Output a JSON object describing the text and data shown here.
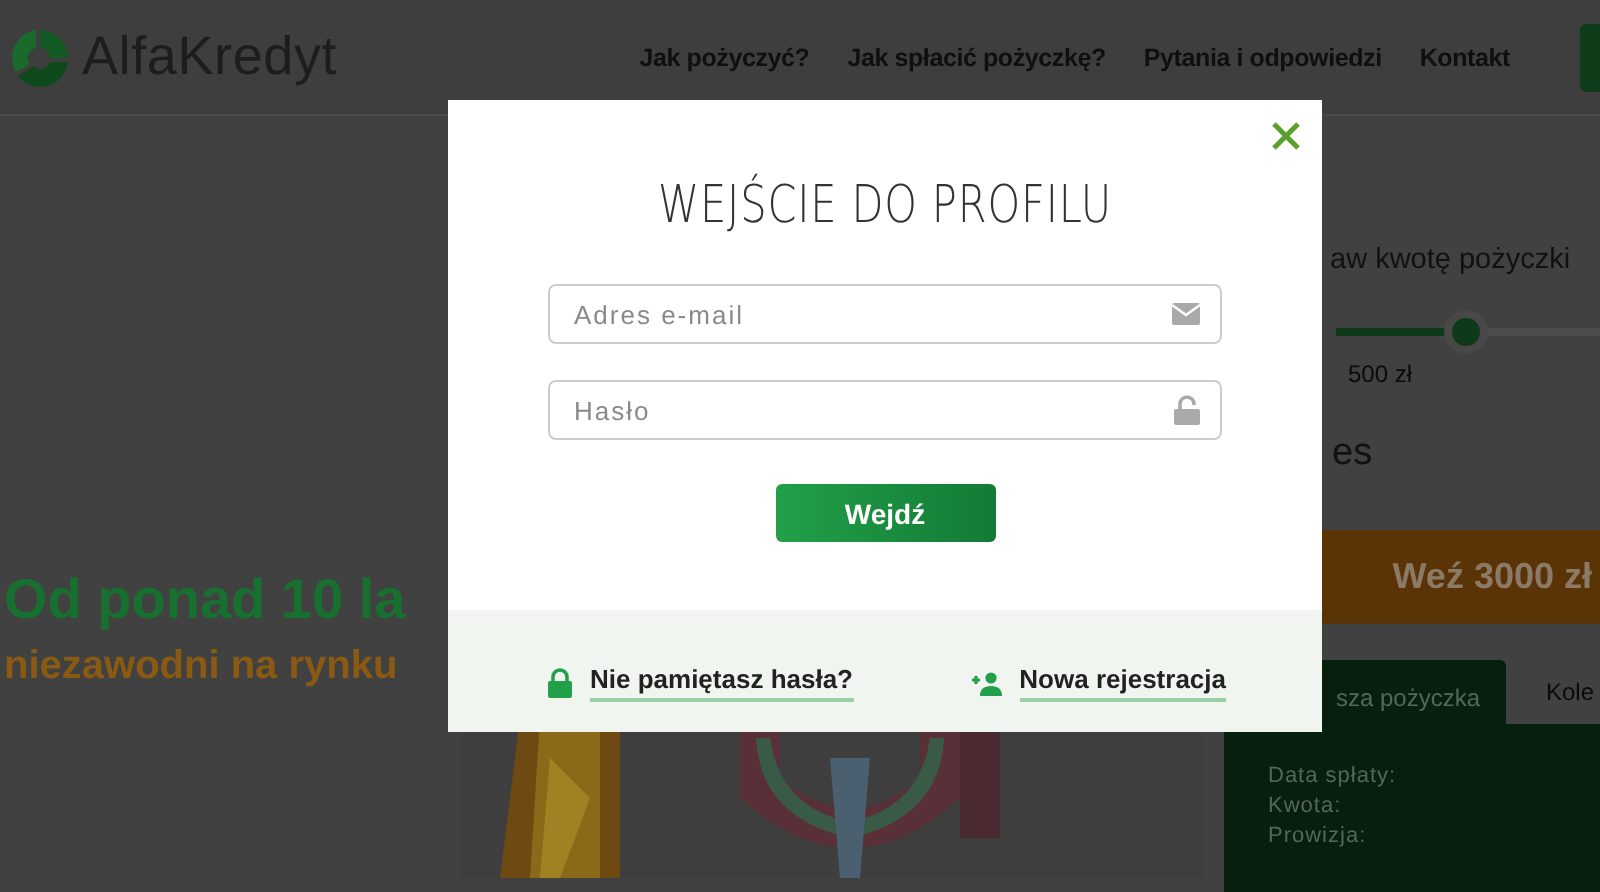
{
  "header": {
    "logo": "AlfaKredyt",
    "nav": [
      "Jak pożyczyć?",
      "Jak spłacić pożyczkę?",
      "Pytania i odpowiedzi",
      "Kontakt"
    ]
  },
  "hero": {
    "title": "Od ponad 10 la",
    "subtitle": "niezawodni na rynku",
    "kind": "picture"
  },
  "calculator": {
    "title": "aw kwotę pożyczki",
    "slider": {
      "level": 0.49
    },
    "min_label": "500 zł",
    "section_text": "es",
    "cta": "Weź 3000 zł",
    "tabs": [
      {
        "label": "sza pożyczka",
        "selected": true
      },
      {
        "label": "Kole",
        "selected": false
      }
    ],
    "fields": [
      "Data spłaty:",
      "Kwota:",
      "Prowizja:"
    ]
  },
  "modal": {
    "title": "WEJŚCIE DO PROFILU",
    "email": {
      "placeholder": "Adres e-mail"
    },
    "password": {
      "placeholder": "Hasło"
    },
    "submit": "Wejdź",
    "forgot_link": "Nie pamiętasz hasła?",
    "register_link": "Nowa rejestracja"
  }
}
